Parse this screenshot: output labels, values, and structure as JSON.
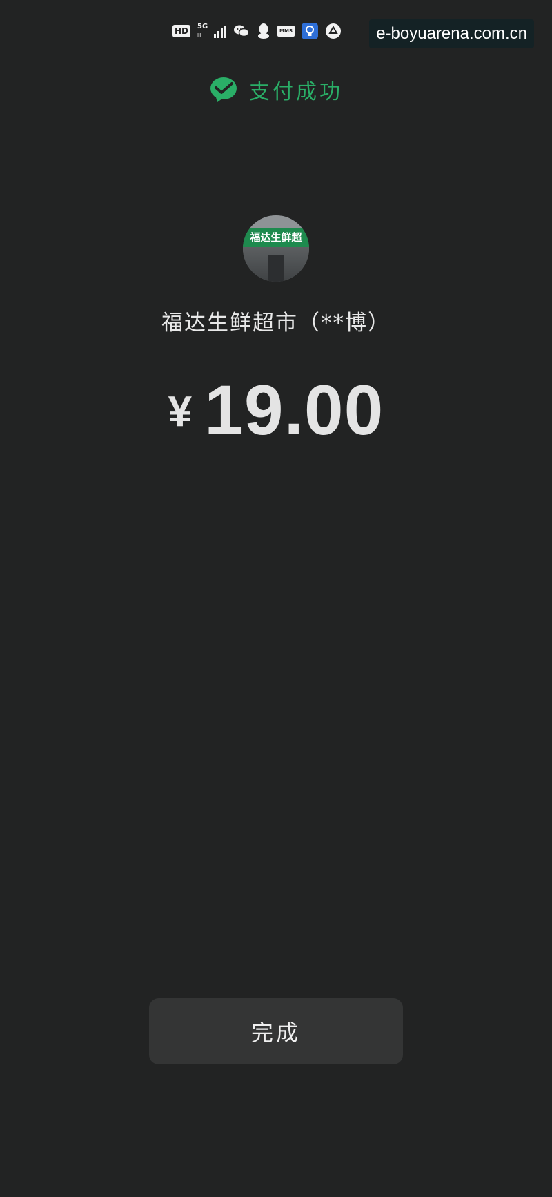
{
  "status_bar": {
    "hd_label": "HD",
    "network_label": "5G",
    "network_sub": "H",
    "mms_label": "MMS",
    "icons": [
      "hd-icon",
      "5g-signal-icon",
      "signal-bars-icon",
      "wechat-icon",
      "qq-icon",
      "mms-icon",
      "bulb-app-icon",
      "app-circle-icon"
    ]
  },
  "watermark": {
    "text": "e-boyuarena.com.cn"
  },
  "header": {
    "icon": "wechat-pay-check-icon",
    "title": "支付成功"
  },
  "merchant": {
    "avatar_sign_text": "福达生鲜超",
    "name": "福达生鲜超市（**博）"
  },
  "payment": {
    "currency_symbol": "¥",
    "amount": "19.00"
  },
  "actions": {
    "done_label": "完成"
  },
  "colors": {
    "background": "#222323",
    "accent_green": "#2aae67",
    "button_bg": "#343535",
    "text_primary": "#e6e6e6"
  }
}
